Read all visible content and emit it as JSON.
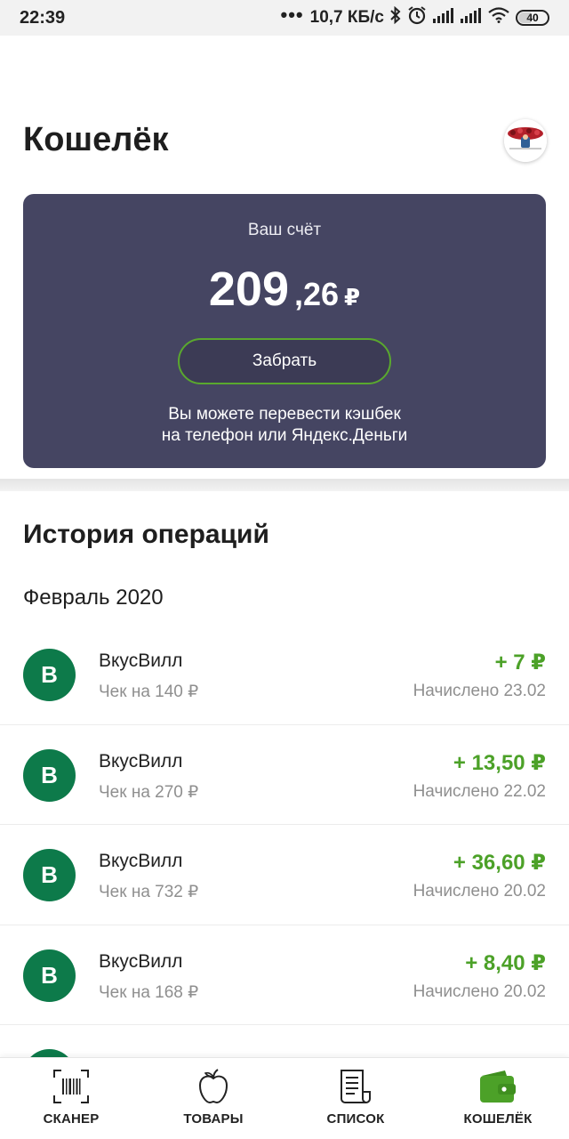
{
  "status_bar": {
    "time": "22:39",
    "network_speed": "10,7 КБ/с",
    "battery": "40"
  },
  "header": {
    "title": "Кошелёк"
  },
  "balance_card": {
    "label": "Ваш счёт",
    "amount_integer": "209",
    "amount_fraction": ",26",
    "currency": "₽",
    "withdraw_button": "Забрать",
    "note_line1": "Вы можете перевести кэшбек",
    "note_line2": "на телефон или Яндекс.Деньги",
    "bg_color": "#454562",
    "button_border_color": "#5aa82e"
  },
  "history": {
    "title": "История операций",
    "month": "Февраль 2020",
    "operations": [
      {
        "logo": "В",
        "name": "ВкусВилл",
        "receipt": "Чек на 140 ₽",
        "amount": "+ 7 ₽",
        "date": "Начислено 23.02"
      },
      {
        "logo": "В",
        "name": "ВкусВилл",
        "receipt": "Чек на 270 ₽",
        "amount": "+ 13,50 ₽",
        "date": "Начислено 22.02"
      },
      {
        "logo": "В",
        "name": "ВкусВилл",
        "receipt": "Чек на 732 ₽",
        "amount": "+ 36,60 ₽",
        "date": "Начислено 20.02"
      },
      {
        "logo": "В",
        "name": "ВкусВилл",
        "receipt": "Чек на 168 ₽",
        "amount": "+ 8,40 ₽",
        "date": "Начислено 20.02"
      }
    ],
    "logo_color": "#0d7a4a",
    "amount_color": "#4ca128"
  },
  "tabbar": {
    "tabs": [
      {
        "label": "СКАНЕР",
        "icon": "barcode-scanner-icon"
      },
      {
        "label": "ТОВАРЫ",
        "icon": "apple-icon"
      },
      {
        "label": "СПИСОК",
        "icon": "list-document-icon"
      },
      {
        "label": "КОШЕЛЁК",
        "icon": "wallet-icon",
        "active": true
      }
    ],
    "active_color": "#4ca128"
  }
}
